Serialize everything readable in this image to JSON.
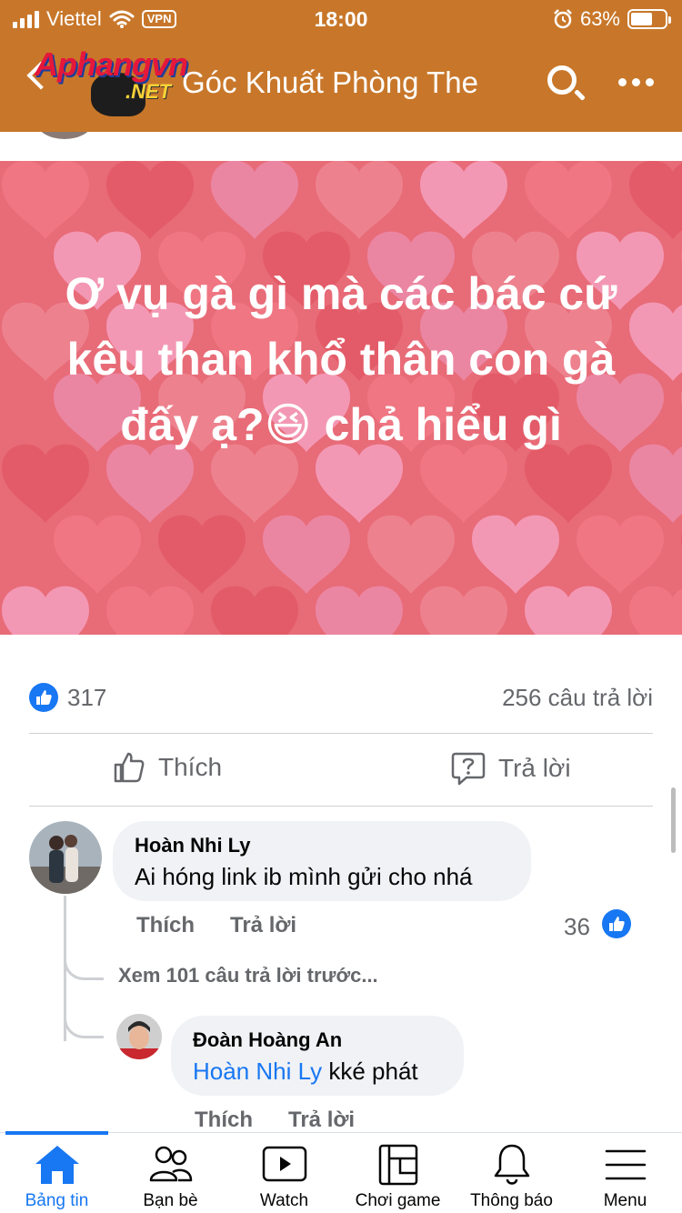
{
  "status_bar": {
    "carrier": "Viettel",
    "vpn": "VPN",
    "time": "18:00",
    "battery": "63%",
    "battery_level": 0.63
  },
  "header": {
    "logo_main": "Aphangvn",
    "logo_sub": ".NET",
    "group_title": "Góc Khuất Phòng The"
  },
  "post": {
    "text": "Ơ vụ gà gì mà các bác cứ kêu than khổ thân con gà  đấy ạ?😆 chả hiểu gì",
    "background_color": "#e86b78",
    "reaction_count": "317",
    "reply_count": "256 câu trả lời",
    "actions": {
      "like": "Thích",
      "reply": "Trả lời"
    }
  },
  "comments": [
    {
      "author": "Hoàn Nhi Ly",
      "text": "Ai hóng link ib mình gửi cho nhá",
      "like_label": "Thích",
      "reply_label": "Trả lời",
      "like_count": "36"
    }
  ],
  "view_more": "Xem 101 câu trả lời trước...",
  "reply": {
    "author": "Đoàn Hoàng An",
    "mention": "Hoàn Nhi Ly",
    "text": " kké phát",
    "like_label": "Thích",
    "reply_label": "Trả lời"
  },
  "tabbar": {
    "active_color": "#1877f2",
    "items": [
      {
        "label": "Bảng tin",
        "icon": "home-icon"
      },
      {
        "label": "Bạn bè",
        "icon": "friends-icon"
      },
      {
        "label": "Watch",
        "icon": "watch-icon"
      },
      {
        "label": "Chơi game",
        "icon": "gaming-icon"
      },
      {
        "label": "Thông báo",
        "icon": "bell-icon"
      },
      {
        "label": "Menu",
        "icon": "menu-icon"
      }
    ]
  }
}
